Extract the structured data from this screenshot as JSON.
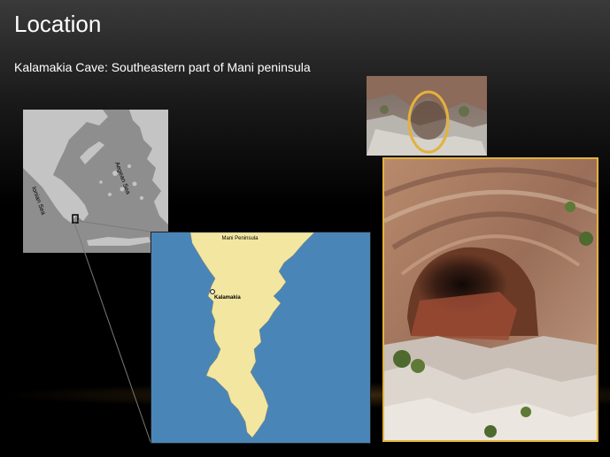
{
  "slide": {
    "title": "Location",
    "subtitle": "Kalamakia Cave: Southeastern part of Mani peninsula"
  },
  "greece_map": {
    "aegean_label": "Aegean Sea",
    "ionian_label": "Ionian Sea"
  },
  "mani_map": {
    "title": "Mani Peninsula",
    "site_label": "Kalamakia"
  },
  "colors": {
    "sea": "#4a85b8",
    "land": "#f3e6a0",
    "highlight": "#e3b23c"
  }
}
